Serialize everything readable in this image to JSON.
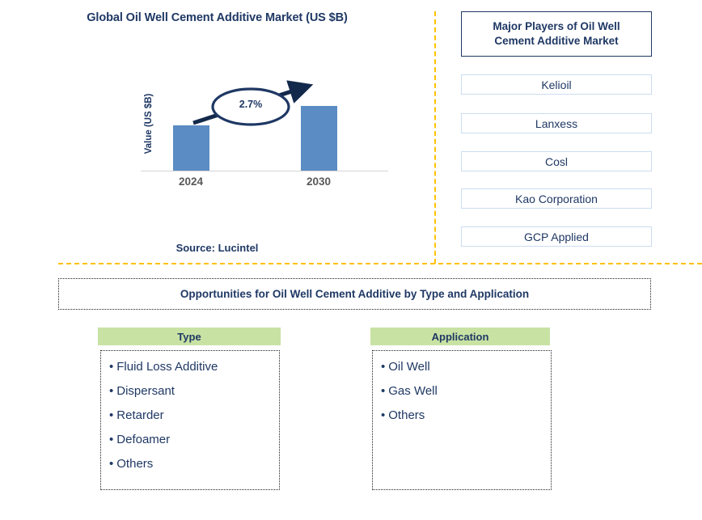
{
  "chart_title": "Global Oil Well Cement Additive Market (US $B)",
  "source": "Source: Lucintel",
  "chart_data": {
    "type": "bar",
    "title": "Global Oil Well Cement Additive Market (US $B)",
    "categories": [
      "2024",
      "2030"
    ],
    "values": [
      56,
      80
    ],
    "xlabel": "",
    "ylabel": "Value (US $B)",
    "grid": false,
    "legend": "none",
    "annotations": [
      {
        "label": "2.7%",
        "type": "cagr-callout",
        "from": "2024",
        "to": "2030"
      }
    ],
    "axis": {
      "y_label": "Value (US $B)",
      "x_tick_labels": [
        "2024",
        "2030"
      ]
    },
    "colors": {
      "bar": "#5B8CC3",
      "axis_line": "#D4D4D4",
      "tick_label": "#595959",
      "callout_outline": "#1F3864"
    }
  },
  "cagr": "2.7%",
  "y_axis_label": "Value (US $B)",
  "years": [
    "2024",
    "2030"
  ],
  "players": {
    "header": "Major Players of Oil Well Cement Additive Market",
    "header_line1": "Major Players of Oil Well",
    "header_line2": "Cement Additive Market",
    "items": [
      "Kelioil",
      "Lanxess",
      "Cosl",
      "Kao Corporation",
      "GCP Applied"
    ]
  },
  "opportunities": {
    "banner": "Opportunities for Oil Well Cement Additive by Type and Application",
    "columns": [
      {
        "header": "Type",
        "items": [
          "Fluid Loss Additive",
          "Dispersant",
          "Retarder",
          "Defoamer",
          "Others"
        ]
      },
      {
        "header": "Application",
        "items": [
          "Oil Well",
          "Gas Well",
          "Others"
        ]
      }
    ]
  },
  "colors": {
    "navy": "#1F3864",
    "bar_blue": "#5B8CC3",
    "divider_orange": "#FFC000",
    "header_green": "#C8E2A4",
    "box_border_blue": "#CBDDF1"
  },
  "bullet_glyph": "•"
}
